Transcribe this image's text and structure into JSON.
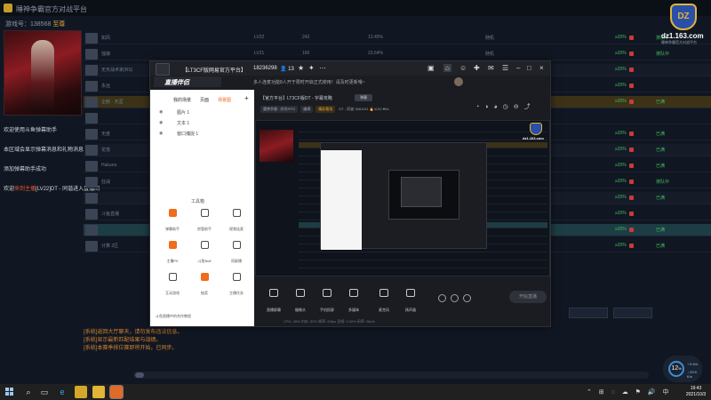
{
  "background_app": {
    "title": "睡神争霸官方对战平台",
    "user_prefix": "游戏号：",
    "user_id": "138568",
    "vip": "至尊",
    "chat_lines": [
      "欢迎使用斗鱼弹幕助手",
      "本区域会显示弹幕消息和礼物消息",
      "添加弹幕助手成功",
      "欢迎来到主播[LV22]DT - 同谐进入直播间"
    ],
    "chat_highlight": "来到主播",
    "rows": [
      {
        "name": "如风",
        "lv": "LV22",
        "col3": "242",
        "pct": "13.45%",
        "mode": "随机",
        "rate": "≥20%",
        "tag": "排队中"
      },
      {
        "name": "独狼",
        "lv": "LV21",
        "col3": "160",
        "pct": "23.64%",
        "mode": "随机",
        "rate": "≥20%",
        "tag": "排队中"
      },
      {
        "name": "无天战术家(RS)",
        "lv": "",
        "col3": "",
        "pct": "",
        "mode": "",
        "rate": "≥20%",
        "tag": ""
      },
      {
        "name": "永远",
        "lv": "",
        "col3": "",
        "pct": "",
        "mode": "",
        "rate": "≥20%",
        "tag": ""
      },
      {
        "name": "企鹅 · 天涯",
        "lv": "",
        "col3": "",
        "pct": "",
        "mode": "",
        "rate": "≥20%",
        "tag": "已满"
      },
      {
        "name": "",
        "lv": "",
        "col3": "",
        "pct": "",
        "mode": "",
        "rate": "",
        "tag": ""
      },
      {
        "name": "无度",
        "lv": "",
        "col3": "",
        "pct": "",
        "mode": "",
        "rate": "≥20%",
        "tag": "已满"
      },
      {
        "name": "花落",
        "lv": "",
        "col3": "",
        "pct": "",
        "mode": "",
        "rate": "≥20%",
        "tag": "已满"
      },
      {
        "name": "Hakuna",
        "lv": "",
        "col3": "",
        "pct": "",
        "mode": "",
        "rate": "≥20%",
        "tag": "已满"
      },
      {
        "name": "狂战",
        "lv": "",
        "col3": "",
        "pct": "",
        "mode": "",
        "rate": "≥20%",
        "tag": "排队中"
      },
      {
        "name": "",
        "lv": "",
        "col3": "",
        "pct": "",
        "mode": "",
        "rate": "≥20%",
        "tag": "已满"
      },
      {
        "name": "斗鱼直播",
        "lv": "",
        "col3": "",
        "pct": "",
        "mode": "",
        "rate": "≥20%",
        "tag": ""
      },
      {
        "name": "",
        "lv": "",
        "col3": "",
        "pct": "",
        "mode": "",
        "rate": "≥20%",
        "tag": "已满"
      },
      {
        "name": "计算 2区",
        "lv": "",
        "col3": "",
        "pct": "",
        "mode": "",
        "rate": "≥20%",
        "tag": "已满"
      }
    ],
    "system_log": [
      "[系统]返回大厅聊天，请勿发布违法信息。",
      "[系统]显示最新匹配结果与战绩。",
      "[系统]本赛季排位赛即将开始，已同步。"
    ],
    "corner_logo": {
      "site": "dz1.163.com",
      "sub": "睡神争霸官方对战平台"
    },
    "gauge": {
      "value": "12",
      "unit": "%",
      "up": "↑ 0 K/s",
      "down": "↓ 29.5 K/s"
    }
  },
  "stream_window": {
    "title": "【LT3CF版网易官方平台】",
    "room_id": "18236298",
    "viewers": "13",
    "brand": "直播伴侣",
    "notice": "多人连麦功能8人开于限时开启正式使用！请及时更新哦~",
    "tabs": [
      "我的场景",
      "页面",
      "场景图"
    ],
    "active_tab": 2,
    "layers": [
      "图片 1",
      "文本 1",
      "窗口捕捉 1"
    ],
    "tools_title": "工具箱",
    "tools": [
      {
        "label": "弹幕助手",
        "orange": true
      },
      {
        "label": "房管助手",
        "orange": false
      },
      {
        "label": "视频连麦",
        "orange": false
      },
      {
        "label": "主播PK",
        "orange": true
      },
      {
        "label": "斗鱼Buff",
        "orange": false
      },
      {
        "label": "同屏播",
        "orange": false
      },
      {
        "label": "互动游戏",
        "orange": false
      },
      {
        "label": "抽奖",
        "orange": true
      },
      {
        "label": "主播任务",
        "orange": false
      }
    ],
    "left_bottom": "斗鱼直播中的合作教程",
    "room_title": "【官方平台】LT3CF版DT - 字幕攻略",
    "room_tag": "弹幕",
    "sub": {
      "category": "魔兽争霸 · 综合RPG",
      "edit": "编辑",
      "weekly": "精彩看场",
      "dt": "DT - 同谐",
      "fans": "3581191",
      "hot": "4132",
      "heart": "64"
    },
    "preview_logo": "dz1.163.com",
    "toolbar": [
      "直播屏幕",
      "摄像头",
      "手机投屏",
      "多媒体",
      "麦克风",
      "扬声器"
    ],
    "start_live": "开始直播",
    "status": "CPU: 28%   内存: 50%   帧率: 60fps   丢帧: 0.00%   码率: 0kb/s"
  },
  "taskbar": {
    "time": "19:43",
    "date": "2021/10/3",
    "tray": "⌃ ⊞ ◌ ☁ ⚑ 🔊 中"
  }
}
